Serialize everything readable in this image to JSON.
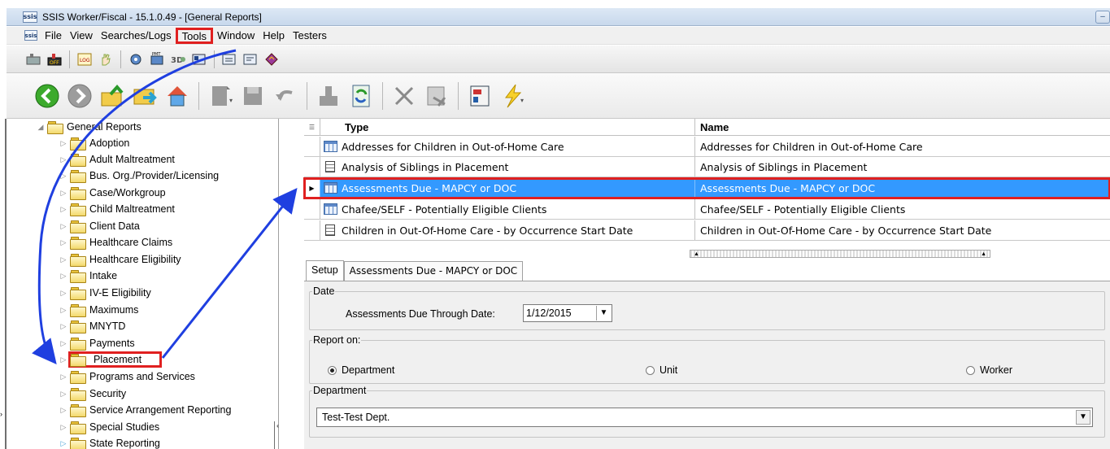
{
  "window": {
    "title": "SSIS Worker/Fiscal - 15.1.0.49 - [General Reports]",
    "app_icon_text": "ssis"
  },
  "menubar": {
    "items": [
      "File",
      "View",
      "Searches/Logs",
      "Tools",
      "Window",
      "Help",
      "Testers"
    ]
  },
  "toolbar_small_icons": [
    "on-icon",
    "off-icon",
    "log-icon",
    "hand-icon",
    "gear-icon",
    "pmt-icon",
    "3d-icon",
    "card-icon",
    "form-icon",
    "form2-icon",
    "diamond-icon"
  ],
  "toolbar_big_icons": [
    "back-icon",
    "forward-icon",
    "folder-up-icon",
    "folder-arrow-icon",
    "home-icon",
    "note-icon",
    "save-icon",
    "undo-icon",
    "stamp-icon",
    "refresh-icon",
    "delete-icon",
    "clear-icon",
    "calc-icon",
    "lightning-icon"
  ],
  "tree": {
    "root": "General Reports",
    "items": [
      "Adoption",
      "Adult Maltreatment",
      "Bus. Org./Provider/Licensing",
      "Case/Workgroup",
      "Child Maltreatment",
      "Client Data",
      "Healthcare Claims",
      "Healthcare Eligibility",
      "Intake",
      "IV-E Eligibility",
      "Maximums",
      "MNYTD",
      "Payments",
      "Placement",
      "Programs and Services",
      "Security",
      "Service Arrangement Reporting",
      "Special Studies",
      "State Reporting"
    ]
  },
  "grid": {
    "columns": [
      "Type",
      "Name"
    ],
    "rows": [
      {
        "icon": "grid",
        "type": "Addresses for Children in Out-of-Home Care",
        "name": "Addresses for Children in Out-of-Home Care"
      },
      {
        "icon": "doc",
        "type": "Analysis of Siblings in Placement",
        "name": "Analysis of Siblings in Placement"
      },
      {
        "icon": "grid",
        "type": "Assessments Due - MAPCY or DOC",
        "name": "Assessments Due - MAPCY or DOC"
      },
      {
        "icon": "grid",
        "type": "Chafee/SELF - Potentially Eligible Clients",
        "name": "Chafee/SELF - Potentially Eligible Clients"
      },
      {
        "icon": "doc",
        "type": "Children in Out-Of-Home Care - by Occurrence Start Date",
        "name": "Children in Out-Of-Home Care - by Occurrence Start Date"
      }
    ]
  },
  "tabs": [
    "Setup",
    "Assessments Due - MAPCY or DOC"
  ],
  "form": {
    "date_group": "Date",
    "date_label": "Assessments Due Through Date:",
    "date_value": "1/12/2015",
    "report_on_group": "Report on:",
    "radio_department": "Department",
    "radio_unit": "Unit",
    "radio_worker": "Worker",
    "department_group": "Department",
    "department_value": "Test-Test Dept."
  },
  "colors": {
    "selection": "#3399ff",
    "highlight_box": "#e02020",
    "arrow": "#1f3fe0"
  }
}
